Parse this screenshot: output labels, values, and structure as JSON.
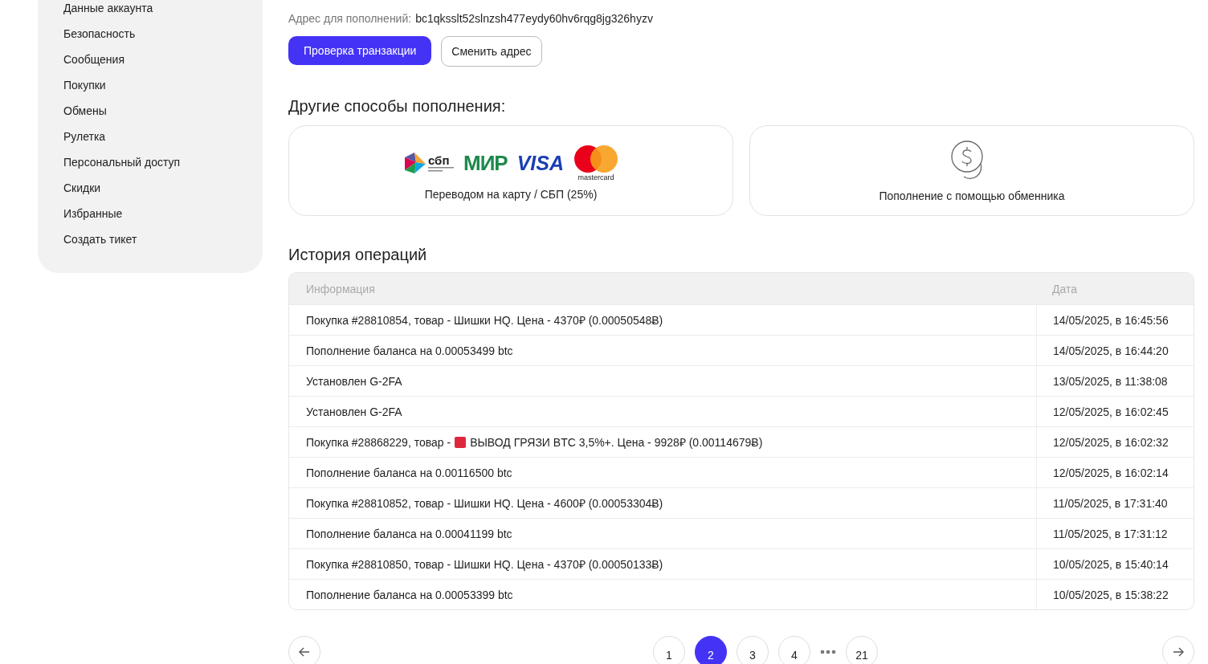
{
  "sidebar": {
    "items": [
      {
        "label": "Данные аккаунта",
        "selected": false
      },
      {
        "label": "Безопасность",
        "selected": false
      },
      {
        "label": "Сообщения",
        "selected": false
      },
      {
        "label": "Покупки",
        "selected": false
      },
      {
        "label": "Обмены",
        "selected": false
      },
      {
        "label": "Рулетка",
        "selected": false
      },
      {
        "label": "Персональный доступ",
        "selected": false
      },
      {
        "label": "Скидки",
        "selected": false
      },
      {
        "label": "Избранные",
        "selected": false
      },
      {
        "label": "Создать тикет",
        "selected": false
      }
    ]
  },
  "deposit": {
    "address_label": "Адрес для пополнений:",
    "address": "bc1qksslt52slnzsh477eydy60hv6rqg8jg326hyzv",
    "buttons": [
      {
        "label": "Проверка транзакции",
        "kind": "primary"
      },
      {
        "label": "Сменить адрес",
        "kind": "outline"
      }
    ]
  },
  "other_methods": {
    "title": "Другие способы пополнения:",
    "cards": [
      {
        "kind": "cards",
        "logos": [
          {
            "kind": "sbp",
            "label": "сбп"
          },
          {
            "kind": "mir",
            "label": "МИР"
          },
          {
            "kind": "visa",
            "label": "VISA"
          },
          {
            "kind": "mastercard",
            "label": "mastercard"
          }
        ],
        "label": "Переводом на карту / СБП (25%)"
      },
      {
        "kind": "exchanger",
        "label": "Пополнение с помощью обменника"
      }
    ]
  },
  "history": {
    "title": "История операций",
    "columns": [
      "Информация",
      "Дата"
    ],
    "rows": [
      {
        "info": "Покупка #28810854, товар - Шишки HQ. Цена - 4370₽ (0.00050548Ƀ)",
        "date": "14/05/2025, в 16:45:56"
      },
      {
        "info": "Пополнение баланса на 0.00053499 btc",
        "date": "14/05/2025, в 16:44:20"
      },
      {
        "info": "Установлен G-2FA",
        "date": "13/05/2025, в 11:38:08"
      },
      {
        "info": "Установлен G-2FA",
        "date": "12/05/2025, в 16:02:45"
      },
      {
        "info": "Покупка #28868229, товар -",
        "color": "#e0283c",
        "info_after": "ВЫВОД ГРЯЗИ BTC 3,5%+. Цена - 9928₽ (0.00114679Ƀ)",
        "date": "12/05/2025, в 16:02:32"
      },
      {
        "info": "Пополнение баланса на 0.00116500 btc",
        "date": "12/05/2025, в 16:02:14"
      },
      {
        "info": "Покупка #28810852, товар - Шишки HQ. Цена - 4600₽ (0.00053304Ƀ)",
        "date": "11/05/2025, в 17:31:40"
      },
      {
        "info": "Пополнение баланса на 0.00041199 btc",
        "date": "11/05/2025, в 17:31:12"
      },
      {
        "info": "Покупка #28810850, товар - Шишки HQ. Цена - 4370₽ (0.00050133Ƀ)",
        "date": "10/05/2025, в 15:40:14"
      },
      {
        "info": "Пополнение баланса на 0.00053399 btc",
        "date": "10/05/2025, в 15:38:22"
      }
    ]
  },
  "pagination": {
    "pages": [
      {
        "label": "1",
        "kind": "page",
        "selected": false
      },
      {
        "label": "2",
        "kind": "page",
        "selected": true
      },
      {
        "label": "3",
        "kind": "page",
        "selected": false
      },
      {
        "label": "4",
        "kind": "page",
        "selected": false
      },
      {
        "kind": "ellipsis"
      },
      {
        "label": "21",
        "kind": "page",
        "selected": false
      }
    ]
  }
}
